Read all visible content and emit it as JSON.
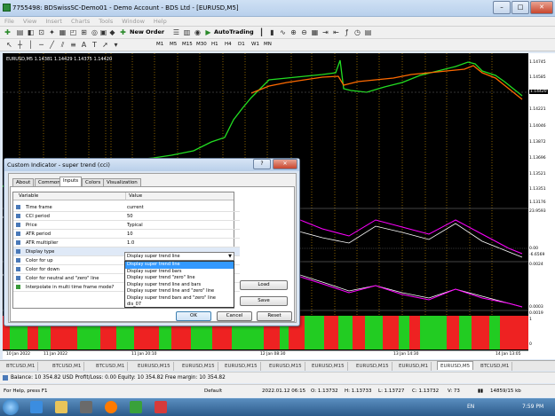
{
  "window": {
    "title": "7755498: BDSwissSC-Demo01 - Demo Account - BDS Ltd - [EURUSD,M5]"
  },
  "menu": [
    "File",
    "View",
    "Insert",
    "Charts",
    "Tools",
    "Window",
    "Help"
  ],
  "toolbar": {
    "new_order": "New Order",
    "auto_trading": "AutoTrading",
    "timeframes": [
      "M1",
      "M5",
      "M15",
      "M30",
      "H1",
      "H4",
      "D1",
      "W1",
      "MN"
    ]
  },
  "chart": {
    "symbol_label": "EURUSD,M5  1.14381 1.14429 1.14375 1.14420",
    "price_ticks": [
      "1.14745",
      "1.14585",
      "1.14420",
      "1.14221",
      "1.14046",
      "1.13872",
      "1.13696",
      "1.13521",
      "1.13351",
      "1.13176"
    ],
    "current_price": "1.14420",
    "sub1_ticks": [
      "23.9593",
      "0.00",
      "-6.6569"
    ],
    "sub2_ticks": [
      "0.0024",
      "0.0003",
      "0.0019"
    ],
    "sub3_ticks": [
      "1",
      "0"
    ],
    "time_ticks": [
      "10 Jan 2022",
      "11 Jan 2022",
      "11 Jan 20:10",
      "12 Jan 08:30",
      "13 Jan 14:30",
      "14 Jan 13:05"
    ]
  },
  "chart_tabs": [
    "BTCUSD,M1",
    "BTCUSD,M1",
    "BTCUSD,M1",
    "EURUSD,M15",
    "EURUSD,M15",
    "EURUSD,M15",
    "EURUSD,M15",
    "EURUSD,M15",
    "EURUSD,M15",
    "EURUSD,M1",
    "EURUSD,M5",
    "BTCUSD,M1"
  ],
  "active_tab": "EURUSD,M5",
  "balance_line": "Balance: 10 354.82 USD   Profit/Loss: 0.00   Equity: 10 354.82   Free margin: 10 354.82",
  "status": {
    "help": "For Help, press F1",
    "profile": "Default",
    "datetime": "2022.01.12 06:15",
    "open": "O: 1.13732",
    "high": "H: 1.13733",
    "low": "L: 1.13727",
    "close": "C: 1.13732",
    "volume": "V: 73",
    "traffic": "14859/15 kb"
  },
  "taskbar": {
    "lang": "EN",
    "time": "7:59 PM"
  },
  "dialog": {
    "title": "Custom Indicator - super trend (cci)",
    "tabs": [
      "About",
      "Common",
      "Inputs",
      "Colors",
      "Visualization"
    ],
    "active_tab": "Inputs",
    "col_variable": "Variable",
    "col_value": "Value",
    "rows": [
      {
        "name": "Time frame",
        "value": "current"
      },
      {
        "name": "CCI period",
        "value": "50"
      },
      {
        "name": "Price",
        "value": "Typical"
      },
      {
        "name": "ATR period",
        "value": "10"
      },
      {
        "name": "ATR multiplier",
        "value": "1.0"
      },
      {
        "name": "Display type",
        "value": "Display super trend line"
      },
      {
        "name": "Color for up",
        "value": ""
      },
      {
        "name": "Color for down",
        "value": ""
      },
      {
        "name": "Color for neutral and \"zero\" line",
        "value": ""
      },
      {
        "name": "Interpolate in multi time frame mode?",
        "value": ""
      }
    ],
    "dropdown_options": [
      "Display super trend line",
      "Display super trend bars",
      "Display super trend \"zero\" line",
      "Display super trend line and bars",
      "Display super trend line and \"zero\" line",
      "Display super trend bars and \"zero\" line",
      "dis_07"
    ],
    "buttons": {
      "load": "Load",
      "save": "Save",
      "ok": "OK",
      "cancel": "Cancel",
      "reset": "Reset"
    }
  }
}
